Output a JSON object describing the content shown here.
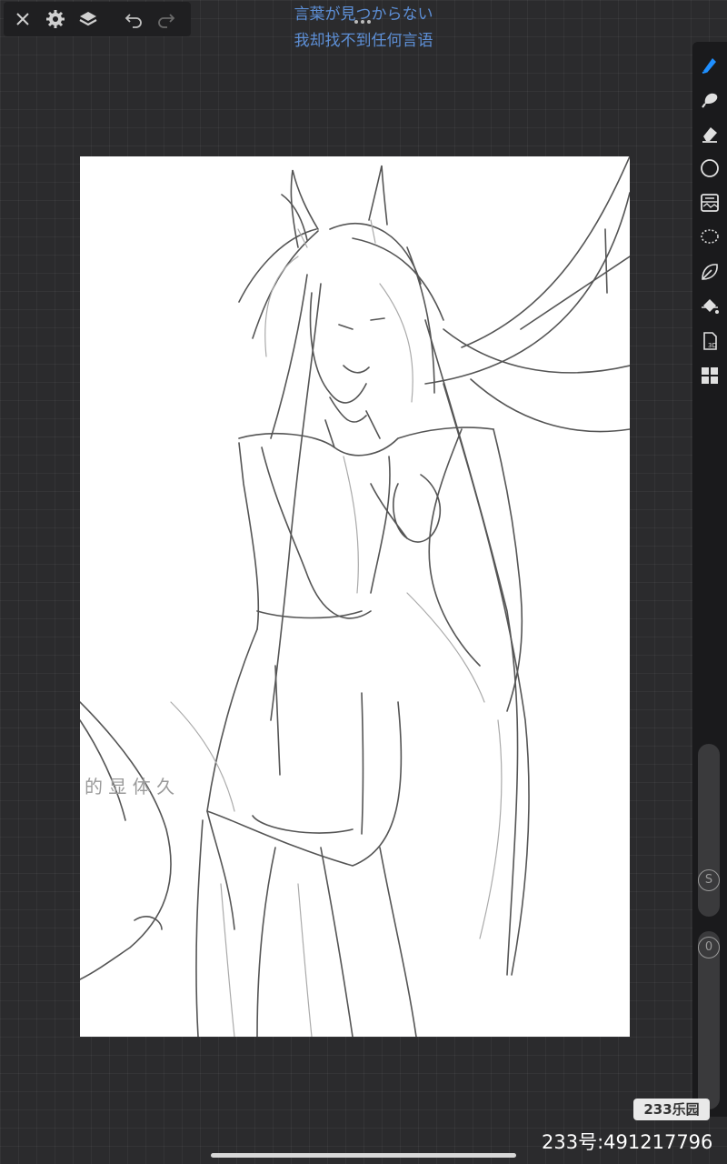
{
  "header": {
    "lyric_line1": "言葉が見つからない",
    "lyric_line2": "我却找不到任何言语"
  },
  "toolbar": {
    "buttons": [
      "close-icon",
      "settings-icon",
      "layers-icon",
      "undo-icon",
      "redo-icon"
    ]
  },
  "tools": [
    "brush-icon",
    "smudge-icon",
    "eraser-icon",
    "color-circle-icon",
    "gallery-icon",
    "lasso-icon",
    "leaf-icon",
    "fill-bucket-icon",
    "3d-icon",
    "grid-icon"
  ],
  "sliders": {
    "size_label": "S",
    "opacity_label": "0"
  },
  "canvas_text": "的 显 体 久",
  "watermark": {
    "logo": "233乐园",
    "id": "233号:491217796"
  },
  "colors": {
    "accent": "#1f8fff",
    "lyric": "#5d8fd6"
  }
}
